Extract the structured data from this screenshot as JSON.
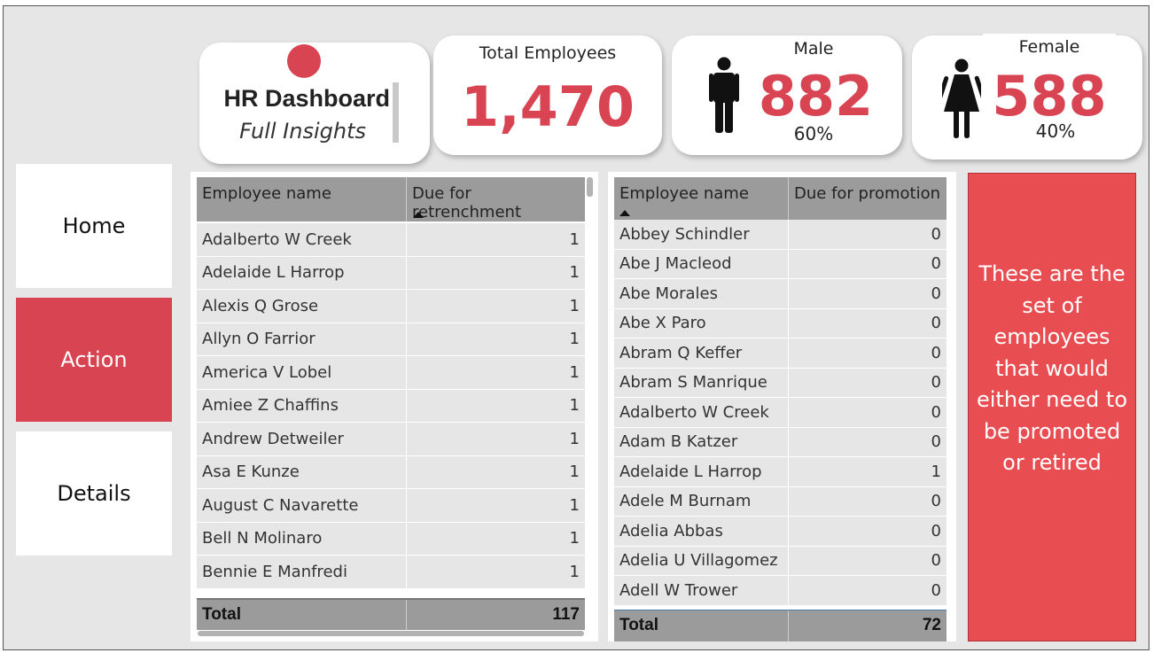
{
  "title": {
    "main": "HR Dashboard",
    "sub": "Full Insights"
  },
  "kpis": {
    "total": {
      "label": "Total Employees",
      "value": "1,470"
    },
    "male": {
      "label": "Male",
      "value": "882",
      "pct": "60%"
    },
    "female": {
      "label": "Female",
      "value": "588",
      "pct": "40%"
    }
  },
  "nav": {
    "home": "Home",
    "action": "Action",
    "details": "Details"
  },
  "retrenchment_table": {
    "headers": [
      "Employee name",
      "Due for retrenchment"
    ],
    "rows": [
      [
        "Adalberto W Creek",
        "1"
      ],
      [
        "Adelaide L Harrop",
        "1"
      ],
      [
        "Alexis Q Grose",
        "1"
      ],
      [
        "Allyn O Farrior",
        "1"
      ],
      [
        "America V Lobel",
        "1"
      ],
      [
        "Amiee Z Chaffins",
        "1"
      ],
      [
        "Andrew Detweiler",
        "1"
      ],
      [
        "Asa E Kunze",
        "1"
      ],
      [
        "August C Navarette",
        "1"
      ],
      [
        "Bell N Molinaro",
        "1"
      ],
      [
        "Bennie E Manfredi",
        "1"
      ]
    ],
    "total": [
      "Total",
      "117"
    ]
  },
  "promotion_table": {
    "headers": [
      "Employee name",
      "Due for promotion"
    ],
    "rows": [
      [
        "Abbey Schindler",
        "0"
      ],
      [
        "Abe J Macleod",
        "0"
      ],
      [
        "Abe Morales",
        "0"
      ],
      [
        "Abe X Paro",
        "0"
      ],
      [
        "Abram Q Keffer",
        "0"
      ],
      [
        "Abram S Manrique",
        "0"
      ],
      [
        "Adalberto W Creek",
        "0"
      ],
      [
        "Adam B Katzer",
        "0"
      ],
      [
        "Adelaide L Harrop",
        "1"
      ],
      [
        "Adele M Burnam",
        "0"
      ],
      [
        "Adelia Abbas",
        "0"
      ],
      [
        "Adelia U Villagomez",
        "0"
      ],
      [
        "Adell W Trower",
        "0"
      ]
    ],
    "total": [
      "Total",
      "72"
    ]
  },
  "info_text": [
    "These are the",
    "set of",
    "employees",
    "that would",
    "either need to",
    "be promoted",
    "or retired"
  ],
  "colors": {
    "accent": "#d94452",
    "panel": "#e84d51",
    "header": "#9b9b9b",
    "row": "#e6e6e6"
  },
  "icons": {
    "male": "male-person-icon",
    "female": "female-person-icon"
  }
}
